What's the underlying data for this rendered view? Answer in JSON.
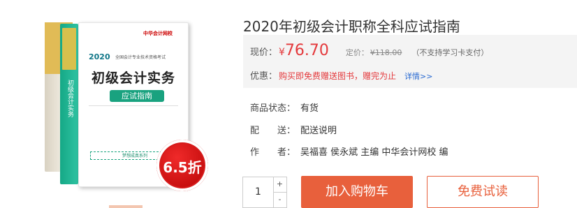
{
  "product": {
    "title": "2020年初级会计职称全科应试指南",
    "image": {
      "front_title": "初级会计实务",
      "front_badge": "应试指南",
      "front_year": "2020",
      "front_sub": "全国会计专业技术资格考试",
      "front_logo": "中华会计网校",
      "front_bar": "梦想成真系列",
      "spine_text": "初级会计实务",
      "discount_seal": "6.5折"
    },
    "price_label": "现价：",
    "currency": "¥",
    "price": "76.70",
    "market_label": "定价：",
    "market_price": "¥118.00",
    "card_note": "（不支持学习卡支付）",
    "promo_label": "优惠：",
    "promo_text": "购买即免费赠送图书，赠完为止",
    "promo_more": "详情>>",
    "status_label": "商品状态：",
    "status_value": "有货",
    "delivery_label": "配　　送：",
    "delivery_value": "配送说明",
    "author_label": "作　　者：",
    "author_value": "吴福喜 侯永斌 主编 中华会计网校 编",
    "quantity": "1",
    "plus": "+",
    "minus": "-",
    "add_to_cart": "加入购物车",
    "free_trial": "免费试读",
    "colors": {
      "accent": "#e8603c",
      "price": "#e4393c",
      "link": "#2a6ad1",
      "panel": "#f4f4f4"
    }
  }
}
